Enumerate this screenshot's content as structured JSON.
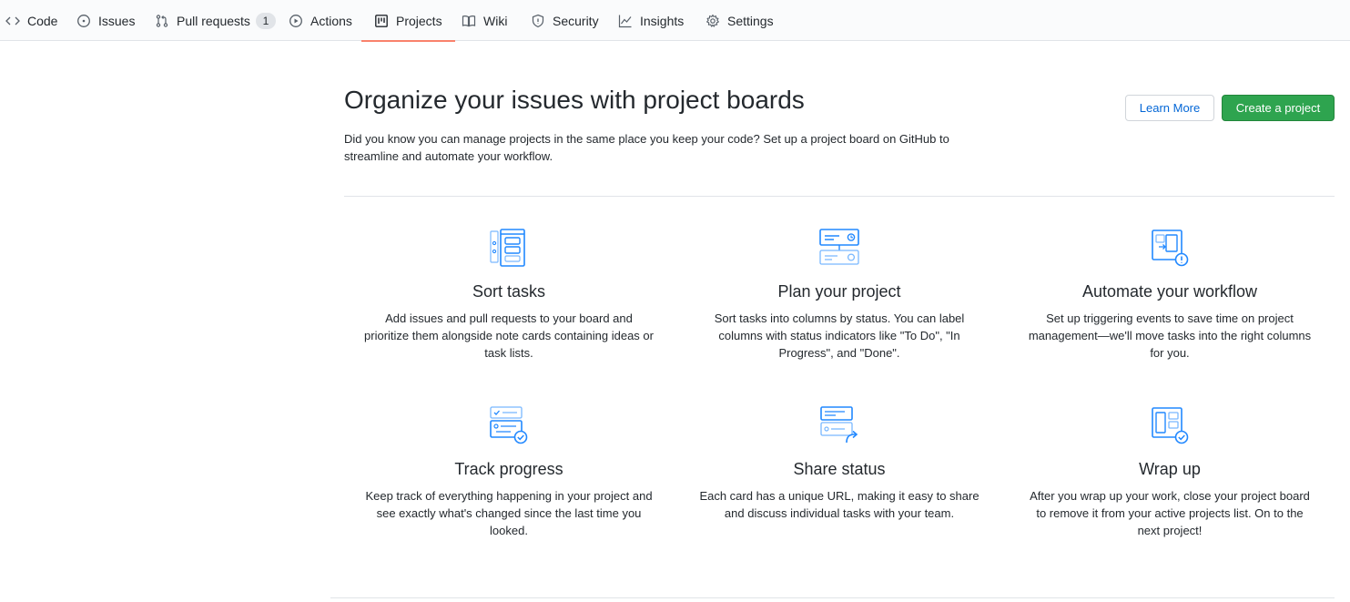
{
  "nav": {
    "tabs": [
      {
        "label": "Code",
        "icon": "code-icon"
      },
      {
        "label": "Issues",
        "icon": "issue-opened-icon"
      },
      {
        "label": "Pull requests",
        "icon": "git-pull-request-icon",
        "count": "1"
      },
      {
        "label": "Actions",
        "icon": "play-icon"
      },
      {
        "label": "Projects",
        "icon": "project-icon",
        "selected": true
      },
      {
        "label": "Wiki",
        "icon": "book-icon"
      },
      {
        "label": "Security",
        "icon": "shield-icon"
      },
      {
        "label": "Insights",
        "icon": "graph-icon"
      },
      {
        "label": "Settings",
        "icon": "gear-icon"
      }
    ]
  },
  "header": {
    "title": "Organize your issues with project boards",
    "description": "Did you know you can manage projects in the same place you keep your code? Set up a project board on GitHub to streamline and automate your workflow.",
    "learn_more_label": "Learn More",
    "create_label": "Create a project"
  },
  "features": [
    {
      "icon": "sort-tasks-icon",
      "title": "Sort tasks",
      "text": "Add issues and pull requests to your board and prioritize them alongside note cards containing ideas or task lists."
    },
    {
      "icon": "plan-project-icon",
      "title": "Plan your project",
      "text": "Sort tasks into columns by status. You can label columns with status indicators like \"To Do\", \"In Progress\", and \"Done\"."
    },
    {
      "icon": "automate-workflow-icon",
      "title": "Automate your workflow",
      "text": "Set up triggering events to save time on project management—we'll move tasks into the right columns for you."
    },
    {
      "icon": "track-progress-icon",
      "title": "Track progress",
      "text": "Keep track of everything happening in your project and see exactly what's changed since the last time you looked."
    },
    {
      "icon": "share-status-icon",
      "title": "Share status",
      "text": "Each card has a unique URL, making it easy to share and discuss individual tasks with your team."
    },
    {
      "icon": "wrap-up-icon",
      "title": "Wrap up",
      "text": "After you wrap up your work, close your project board to remove it from your active projects list. On to the next project!"
    }
  ],
  "colors": {
    "accent_blue": "#0366d6",
    "illustration_blue": "#2188ff",
    "create_green": "#2ea44f",
    "selected_underline": "#f9826c"
  }
}
